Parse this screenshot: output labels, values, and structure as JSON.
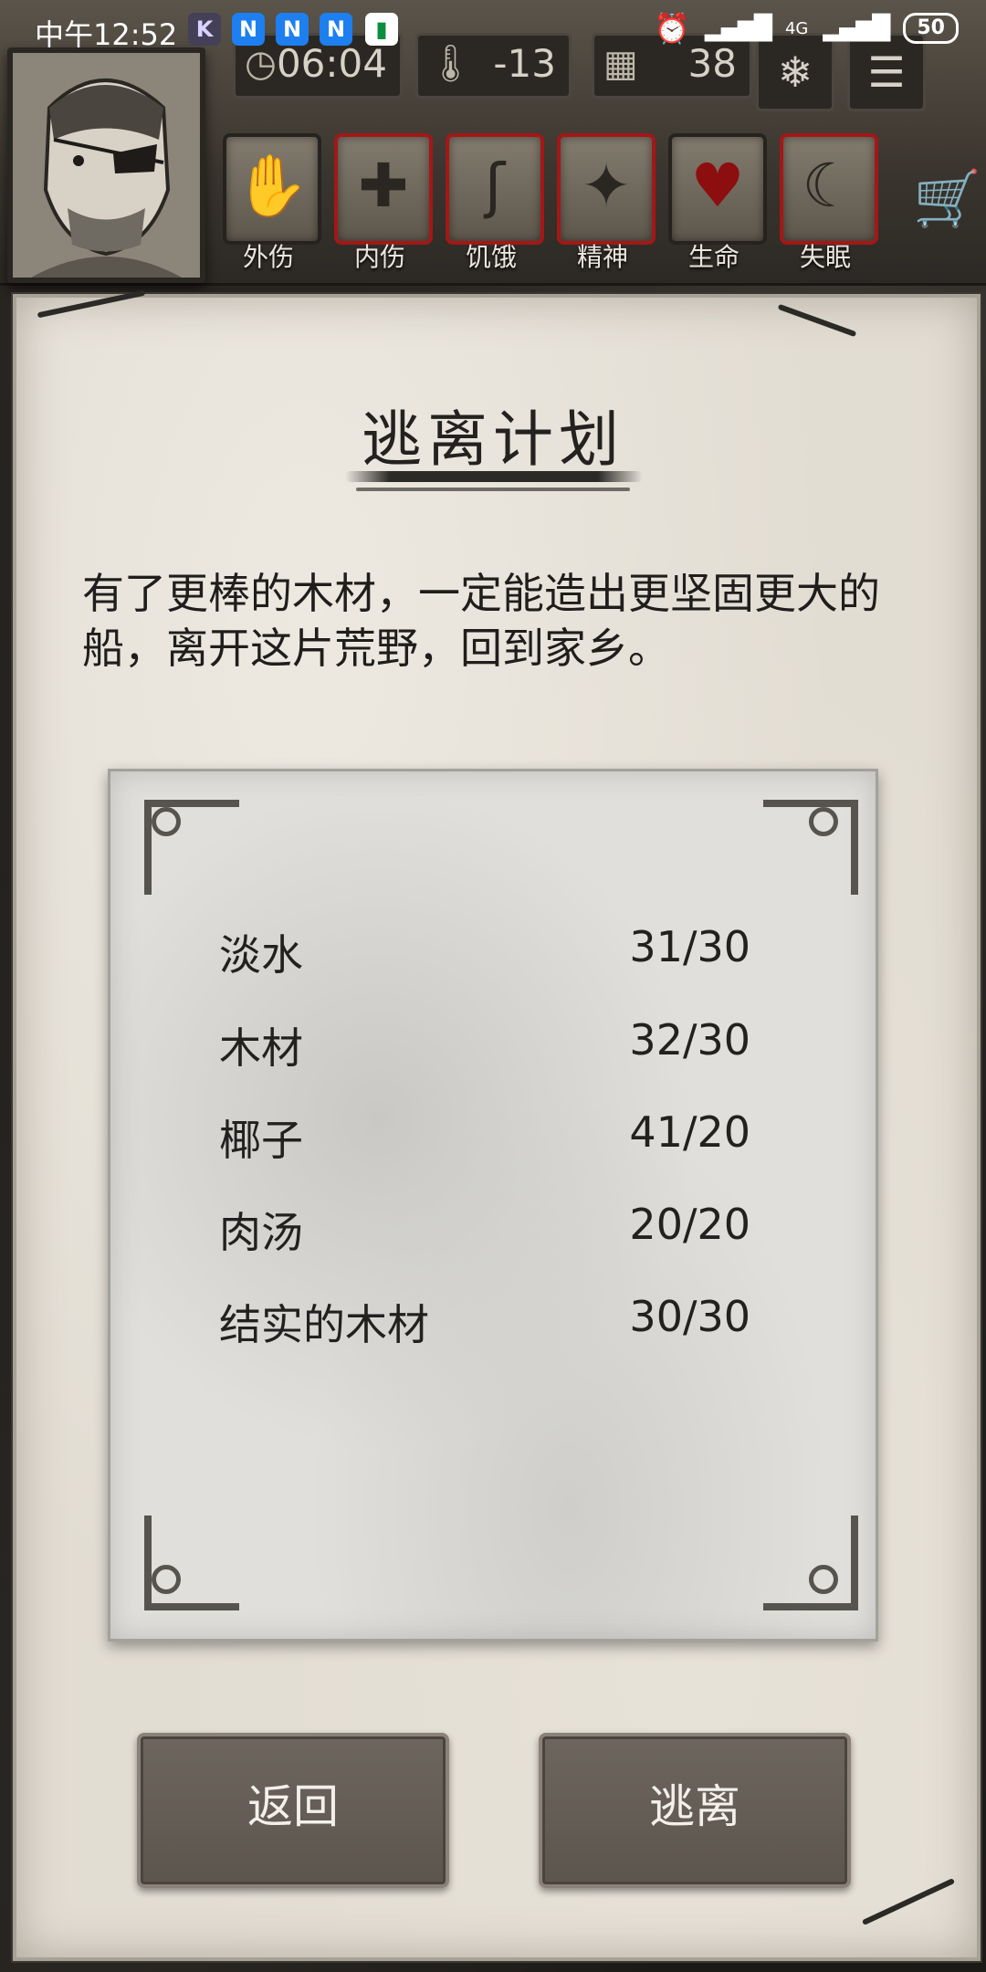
{
  "status_bar": {
    "time": "中午12:52",
    "notifications": [
      "K",
      "N",
      "N",
      "N",
      "chat"
    ],
    "network": "4G",
    "battery": "50"
  },
  "hud": {
    "clock": "06:04",
    "temperature": "-13",
    "day": "38",
    "portrait": "eyepatch-survivor-portrait",
    "status_icons": [
      {
        "label": "外伤",
        "icon": "bandaged-hand-icon",
        "alert": false
      },
      {
        "label": "内伤",
        "icon": "cross-icon",
        "alert": true
      },
      {
        "label": "饥饿",
        "icon": "stomach-icon",
        "alert": true
      },
      {
        "label": "精神",
        "icon": "head-sparkle-icon",
        "alert": true
      },
      {
        "label": "生命",
        "icon": "heart-icon",
        "alert": false
      },
      {
        "label": "失眠",
        "icon": "moon-star-icon",
        "alert": true
      }
    ]
  },
  "dialog": {
    "title": "逃离计划",
    "description": "有了更棒的木材，一定能造出更坚固更大的船，离开这片荒野，回到家乡。",
    "requirements": [
      {
        "name": "淡水",
        "count": "31/30"
      },
      {
        "name": "木材",
        "count": "32/30"
      },
      {
        "name": "椰子",
        "count": "41/20"
      },
      {
        "name": "肉汤",
        "count": "20/20"
      },
      {
        "name": "结实的木材",
        "count": "30/30"
      }
    ],
    "buttons": {
      "back": "返回",
      "escape": "逃离"
    }
  },
  "colors": {
    "alert_border": "#a41717",
    "parchment": "#e2ddd3",
    "button": "#615a52",
    "heart": "#8d0e0e"
  }
}
